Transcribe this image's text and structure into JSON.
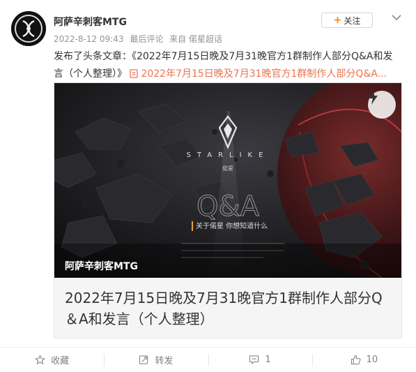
{
  "author": {
    "name": "阿萨辛刺客MTG",
    "avatar_icon": "assassin-logo-icon"
  },
  "meta": {
    "date": "2022-8-12 09:43",
    "edited": "最后评论",
    "source": "来自 偌星超话"
  },
  "follow": {
    "label": "关注",
    "icon": "plus-icon"
  },
  "menu_icon": "chevron-down-icon",
  "post_text": {
    "prefix": "发布了头条文章：《2022年7月15日晚及7月31晚官方1群制作人部分Q&A和发言（个人整理）》",
    "link_text": "2022年7月15日晚及7月31晚官方1群制作人部分Q&A...",
    "link_icon": "article-icon"
  },
  "card": {
    "source_label": "阿萨辛刺客MTG",
    "flash_icon": "lightning-icon",
    "title": "2022年7月15日晚及7月31晚官方1群制作人部分Q＆A和发言（个人整理）",
    "image": {
      "brand": "STARLIKE",
      "brand_cn": "偌星",
      "qa_text": "Q&A",
      "tagline": "关于偌星 你想知道什么"
    }
  },
  "actions": [
    {
      "label": "收藏",
      "icon": "star-icon"
    },
    {
      "label": "转发",
      "icon": "repost-icon"
    },
    {
      "label": "1",
      "icon": "comment-icon"
    },
    {
      "label": "10",
      "icon": "like-icon"
    }
  ],
  "colors": {
    "link": "#eb7350",
    "follow_plus": "#ff8200",
    "muted": "#939393"
  }
}
